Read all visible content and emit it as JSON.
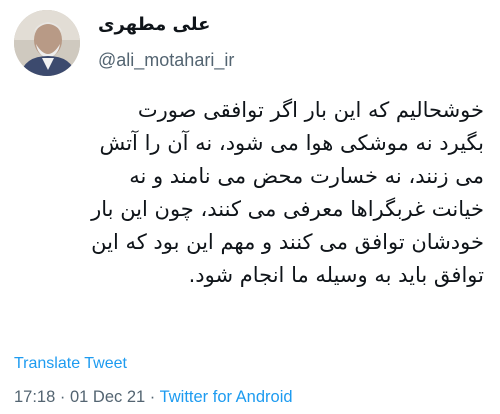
{
  "author": {
    "display_name": "علی مطهری",
    "handle": "@ali_motahari_ir",
    "avatar_icon": "user-avatar-photo"
  },
  "tweet": {
    "lines": [
      "خوشحالیم که این بار اگر توافقی صورت",
      "بگیرد نه موشکی هوا می شود، نه آن را آتش",
      "می زنند، نه خسارت محض می نامند و نه",
      "خیانت غربگراها معرفی می کنند، چون این بار",
      "خودشان توافق می کنند و مهم این بود که این",
      "توافق باید به وسیله ما انجام شود."
    ]
  },
  "actions": {
    "translate_label": "Translate Tweet"
  },
  "meta": {
    "time": "17:18",
    "separator1": " · ",
    "date": "01 Dec 21",
    "separator2": " · ",
    "source": "Twitter for Android"
  },
  "colors": {
    "link": "#1d9bf0",
    "secondary_text": "#536471",
    "primary_text": "#0f1419"
  }
}
